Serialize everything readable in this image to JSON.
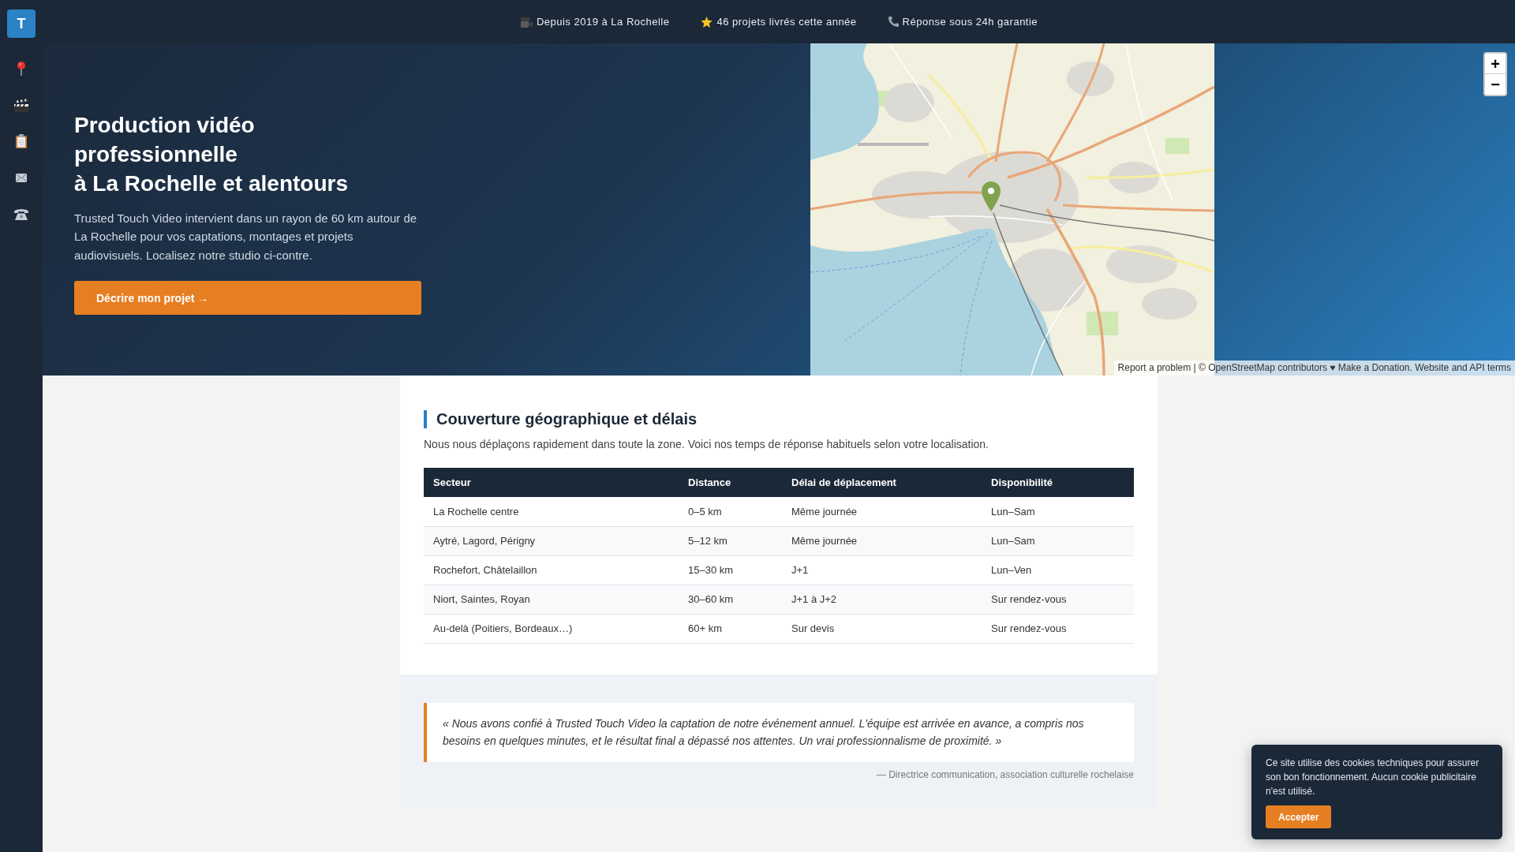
{
  "sidebar": {
    "logo": "T"
  },
  "top_bar": {
    "items": [
      "Depuis 2019 à La Rochelle",
      "46 projets livrés cette année",
      "Réponse sous 24h garantie"
    ]
  },
  "hero": {
    "title_lines": [
      "Production vidéo professionnelle",
      "à La Rochelle et alentours"
    ],
    "text": "Trusted Touch Video intervient dans un rayon de 60 km autour de La Rochelle pour vos captations, montages et projets audiovisuels. Localisez notre studio ci-contre.",
    "button": "Décrire mon projet →"
  },
  "map": {
    "zoom_in": "+",
    "zoom_out": "−",
    "attribution": "Report a problem | © OpenStreetMap contributors ♥ Make a Donation. Website and API terms"
  },
  "coverage": {
    "title": "Couverture géographique et délais",
    "intro": "Nous nous déplaçons rapidement dans toute la zone. Voici nos temps de réponse habituels selon votre localisation.",
    "table": {
      "columns": [
        "Secteur",
        "Distance",
        "Délai de déplacement",
        "Disponibilité"
      ],
      "rows": [
        [
          "La Rochelle centre",
          "0–5 km",
          "Même journée",
          "Lun–Sam"
        ],
        [
          "Aytré, Lagord, Périgny",
          "5–12 km",
          "Même journée",
          "Lun–Sam"
        ],
        [
          "Rochefort, Châtelaillon",
          "15–30 km",
          "J+1",
          "Lun–Ven"
        ],
        [
          "Niort, Saintes, Royan",
          "30–60 km",
          "J+1 à J+2",
          "Sur rendez-vous"
        ],
        [
          "Au-delà (Poitiers, Bordeaux…)",
          "60+ km",
          "Sur devis",
          "Sur rendez-vous"
        ]
      ]
    }
  },
  "testimonial": {
    "quote": "« Nous avons confié à Trusted Touch Video la captation de notre événement annuel. L'équipe est arrivée en avance, a compris nos besoins en quelques minutes, et le résultat final a dépassé nos attentes. Un vrai professionnalisme de proximité. »",
    "author": "— Directrice communication, association culturelle rochelaise"
  },
  "cookie_banner": {
    "text": "Ce site utilise des cookies techniques pour assurer son bon fonctionnement. Aucun cookie publicitaire n'est utilisé.",
    "button": "Accepter"
  }
}
